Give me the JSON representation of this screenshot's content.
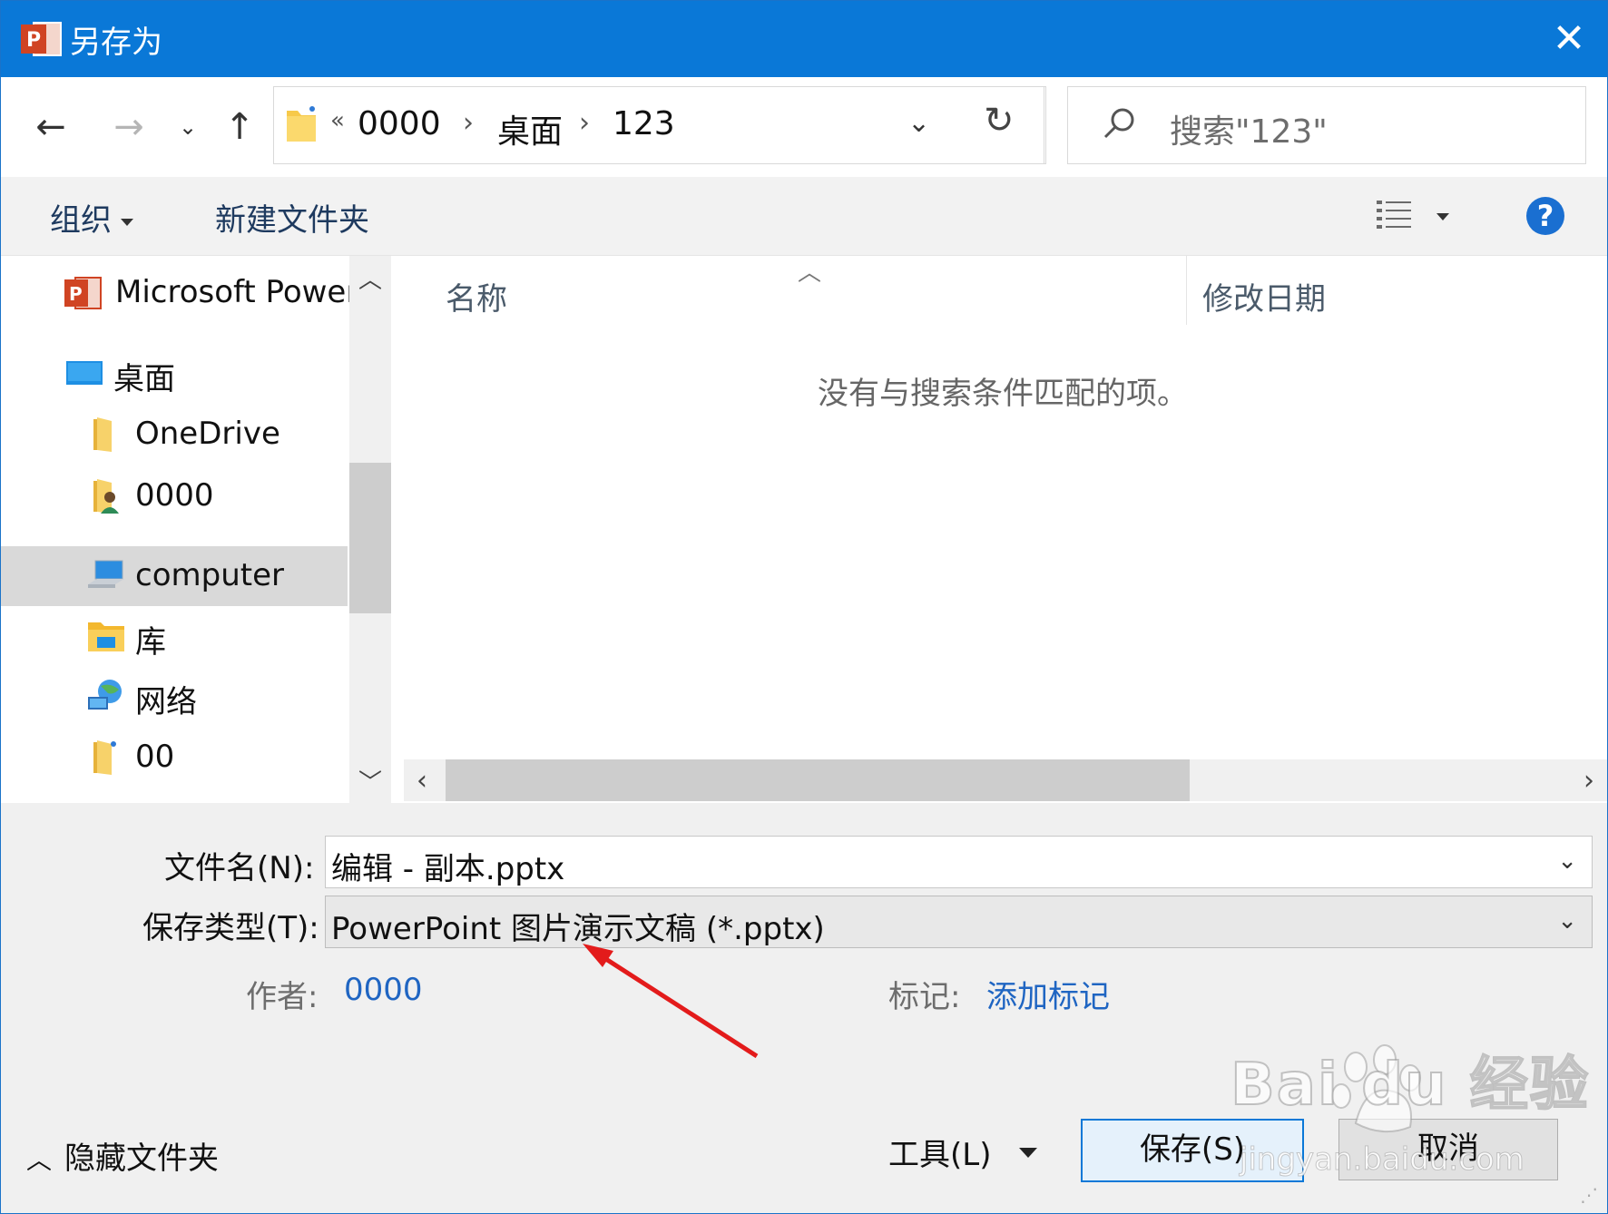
{
  "window": {
    "title": "另存为"
  },
  "nav": {
    "breadcrumb_overflow": "«",
    "breadcrumbs": [
      "0000",
      "桌面",
      "123"
    ],
    "search_placeholder": "搜索\"123\""
  },
  "commands": {
    "organize": "组织",
    "new_folder": "新建文件夹",
    "help": "?"
  },
  "tree": {
    "items": [
      {
        "label": "Microsoft PowerPoint",
        "icon": "powerpoint-icon",
        "selected": false
      },
      {
        "label": "桌面",
        "icon": "desktop-icon",
        "selected": false
      },
      {
        "label": "OneDrive",
        "icon": "folder-icon",
        "selected": false
      },
      {
        "label": "0000",
        "icon": "user-folder-icon",
        "selected": false
      },
      {
        "label": "computer",
        "icon": "computer-icon",
        "selected": true
      },
      {
        "label": "库",
        "icon": "library-icon",
        "selected": false
      },
      {
        "label": "网络",
        "icon": "network-icon",
        "selected": false
      },
      {
        "label": "00",
        "icon": "folder-icon",
        "selected": false
      }
    ]
  },
  "list": {
    "columns": [
      "名称",
      "修改日期"
    ],
    "empty_message": "没有与搜索条件匹配的项。"
  },
  "form": {
    "filename_label": "文件名(N):",
    "filename_value": "编辑 - 副本.pptx",
    "filetype_label": "保存类型(T):",
    "filetype_value": "PowerPoint 图片演示文稿 (*.pptx)",
    "author_label": "作者:",
    "author_value": "0000",
    "tags_label": "标记:",
    "tags_value": "添加标记"
  },
  "footer": {
    "hide_folders": "隐藏文件夹",
    "tools": "工具(L)",
    "save": "保存(S)",
    "cancel": "取消"
  },
  "watermark": {
    "brand": "Bai  du 经验",
    "url": "jingyan.baidu.com"
  },
  "colors": {
    "titlebar": "#0a78d7",
    "annotation_arrow": "#e31b1b",
    "link": "#1f65c2"
  }
}
